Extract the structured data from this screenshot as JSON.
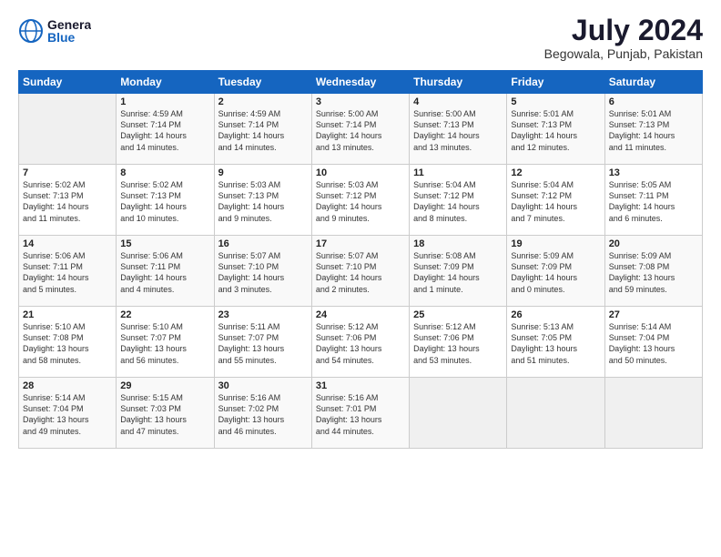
{
  "header": {
    "logo_line1": "General",
    "logo_line2": "Blue",
    "month": "July 2024",
    "location": "Begowala, Punjab, Pakistan"
  },
  "days_of_week": [
    "Sunday",
    "Monday",
    "Tuesday",
    "Wednesday",
    "Thursday",
    "Friday",
    "Saturday"
  ],
  "weeks": [
    [
      {
        "day": "",
        "info": ""
      },
      {
        "day": "1",
        "info": "Sunrise: 4:59 AM\nSunset: 7:14 PM\nDaylight: 14 hours\nand 14 minutes."
      },
      {
        "day": "2",
        "info": "Sunrise: 4:59 AM\nSunset: 7:14 PM\nDaylight: 14 hours\nand 14 minutes."
      },
      {
        "day": "3",
        "info": "Sunrise: 5:00 AM\nSunset: 7:14 PM\nDaylight: 14 hours\nand 13 minutes."
      },
      {
        "day": "4",
        "info": "Sunrise: 5:00 AM\nSunset: 7:13 PM\nDaylight: 14 hours\nand 13 minutes."
      },
      {
        "day": "5",
        "info": "Sunrise: 5:01 AM\nSunset: 7:13 PM\nDaylight: 14 hours\nand 12 minutes."
      },
      {
        "day": "6",
        "info": "Sunrise: 5:01 AM\nSunset: 7:13 PM\nDaylight: 14 hours\nand 11 minutes."
      }
    ],
    [
      {
        "day": "7",
        "info": "Sunrise: 5:02 AM\nSunset: 7:13 PM\nDaylight: 14 hours\nand 11 minutes."
      },
      {
        "day": "8",
        "info": "Sunrise: 5:02 AM\nSunset: 7:13 PM\nDaylight: 14 hours\nand 10 minutes."
      },
      {
        "day": "9",
        "info": "Sunrise: 5:03 AM\nSunset: 7:13 PM\nDaylight: 14 hours\nand 9 minutes."
      },
      {
        "day": "10",
        "info": "Sunrise: 5:03 AM\nSunset: 7:12 PM\nDaylight: 14 hours\nand 9 minutes."
      },
      {
        "day": "11",
        "info": "Sunrise: 5:04 AM\nSunset: 7:12 PM\nDaylight: 14 hours\nand 8 minutes."
      },
      {
        "day": "12",
        "info": "Sunrise: 5:04 AM\nSunset: 7:12 PM\nDaylight: 14 hours\nand 7 minutes."
      },
      {
        "day": "13",
        "info": "Sunrise: 5:05 AM\nSunset: 7:11 PM\nDaylight: 14 hours\nand 6 minutes."
      }
    ],
    [
      {
        "day": "14",
        "info": "Sunrise: 5:06 AM\nSunset: 7:11 PM\nDaylight: 14 hours\nand 5 minutes."
      },
      {
        "day": "15",
        "info": "Sunrise: 5:06 AM\nSunset: 7:11 PM\nDaylight: 14 hours\nand 4 minutes."
      },
      {
        "day": "16",
        "info": "Sunrise: 5:07 AM\nSunset: 7:10 PM\nDaylight: 14 hours\nand 3 minutes."
      },
      {
        "day": "17",
        "info": "Sunrise: 5:07 AM\nSunset: 7:10 PM\nDaylight: 14 hours\nand 2 minutes."
      },
      {
        "day": "18",
        "info": "Sunrise: 5:08 AM\nSunset: 7:09 PM\nDaylight: 14 hours\nand 1 minute."
      },
      {
        "day": "19",
        "info": "Sunrise: 5:09 AM\nSunset: 7:09 PM\nDaylight: 14 hours\nand 0 minutes."
      },
      {
        "day": "20",
        "info": "Sunrise: 5:09 AM\nSunset: 7:08 PM\nDaylight: 13 hours\nand 59 minutes."
      }
    ],
    [
      {
        "day": "21",
        "info": "Sunrise: 5:10 AM\nSunset: 7:08 PM\nDaylight: 13 hours\nand 58 minutes."
      },
      {
        "day": "22",
        "info": "Sunrise: 5:10 AM\nSunset: 7:07 PM\nDaylight: 13 hours\nand 56 minutes."
      },
      {
        "day": "23",
        "info": "Sunrise: 5:11 AM\nSunset: 7:07 PM\nDaylight: 13 hours\nand 55 minutes."
      },
      {
        "day": "24",
        "info": "Sunrise: 5:12 AM\nSunset: 7:06 PM\nDaylight: 13 hours\nand 54 minutes."
      },
      {
        "day": "25",
        "info": "Sunrise: 5:12 AM\nSunset: 7:06 PM\nDaylight: 13 hours\nand 53 minutes."
      },
      {
        "day": "26",
        "info": "Sunrise: 5:13 AM\nSunset: 7:05 PM\nDaylight: 13 hours\nand 51 minutes."
      },
      {
        "day": "27",
        "info": "Sunrise: 5:14 AM\nSunset: 7:04 PM\nDaylight: 13 hours\nand 50 minutes."
      }
    ],
    [
      {
        "day": "28",
        "info": "Sunrise: 5:14 AM\nSunset: 7:04 PM\nDaylight: 13 hours\nand 49 minutes."
      },
      {
        "day": "29",
        "info": "Sunrise: 5:15 AM\nSunset: 7:03 PM\nDaylight: 13 hours\nand 47 minutes."
      },
      {
        "day": "30",
        "info": "Sunrise: 5:16 AM\nSunset: 7:02 PM\nDaylight: 13 hours\nand 46 minutes."
      },
      {
        "day": "31",
        "info": "Sunrise: 5:16 AM\nSunset: 7:01 PM\nDaylight: 13 hours\nand 44 minutes."
      },
      {
        "day": "",
        "info": ""
      },
      {
        "day": "",
        "info": ""
      },
      {
        "day": "",
        "info": ""
      }
    ]
  ]
}
